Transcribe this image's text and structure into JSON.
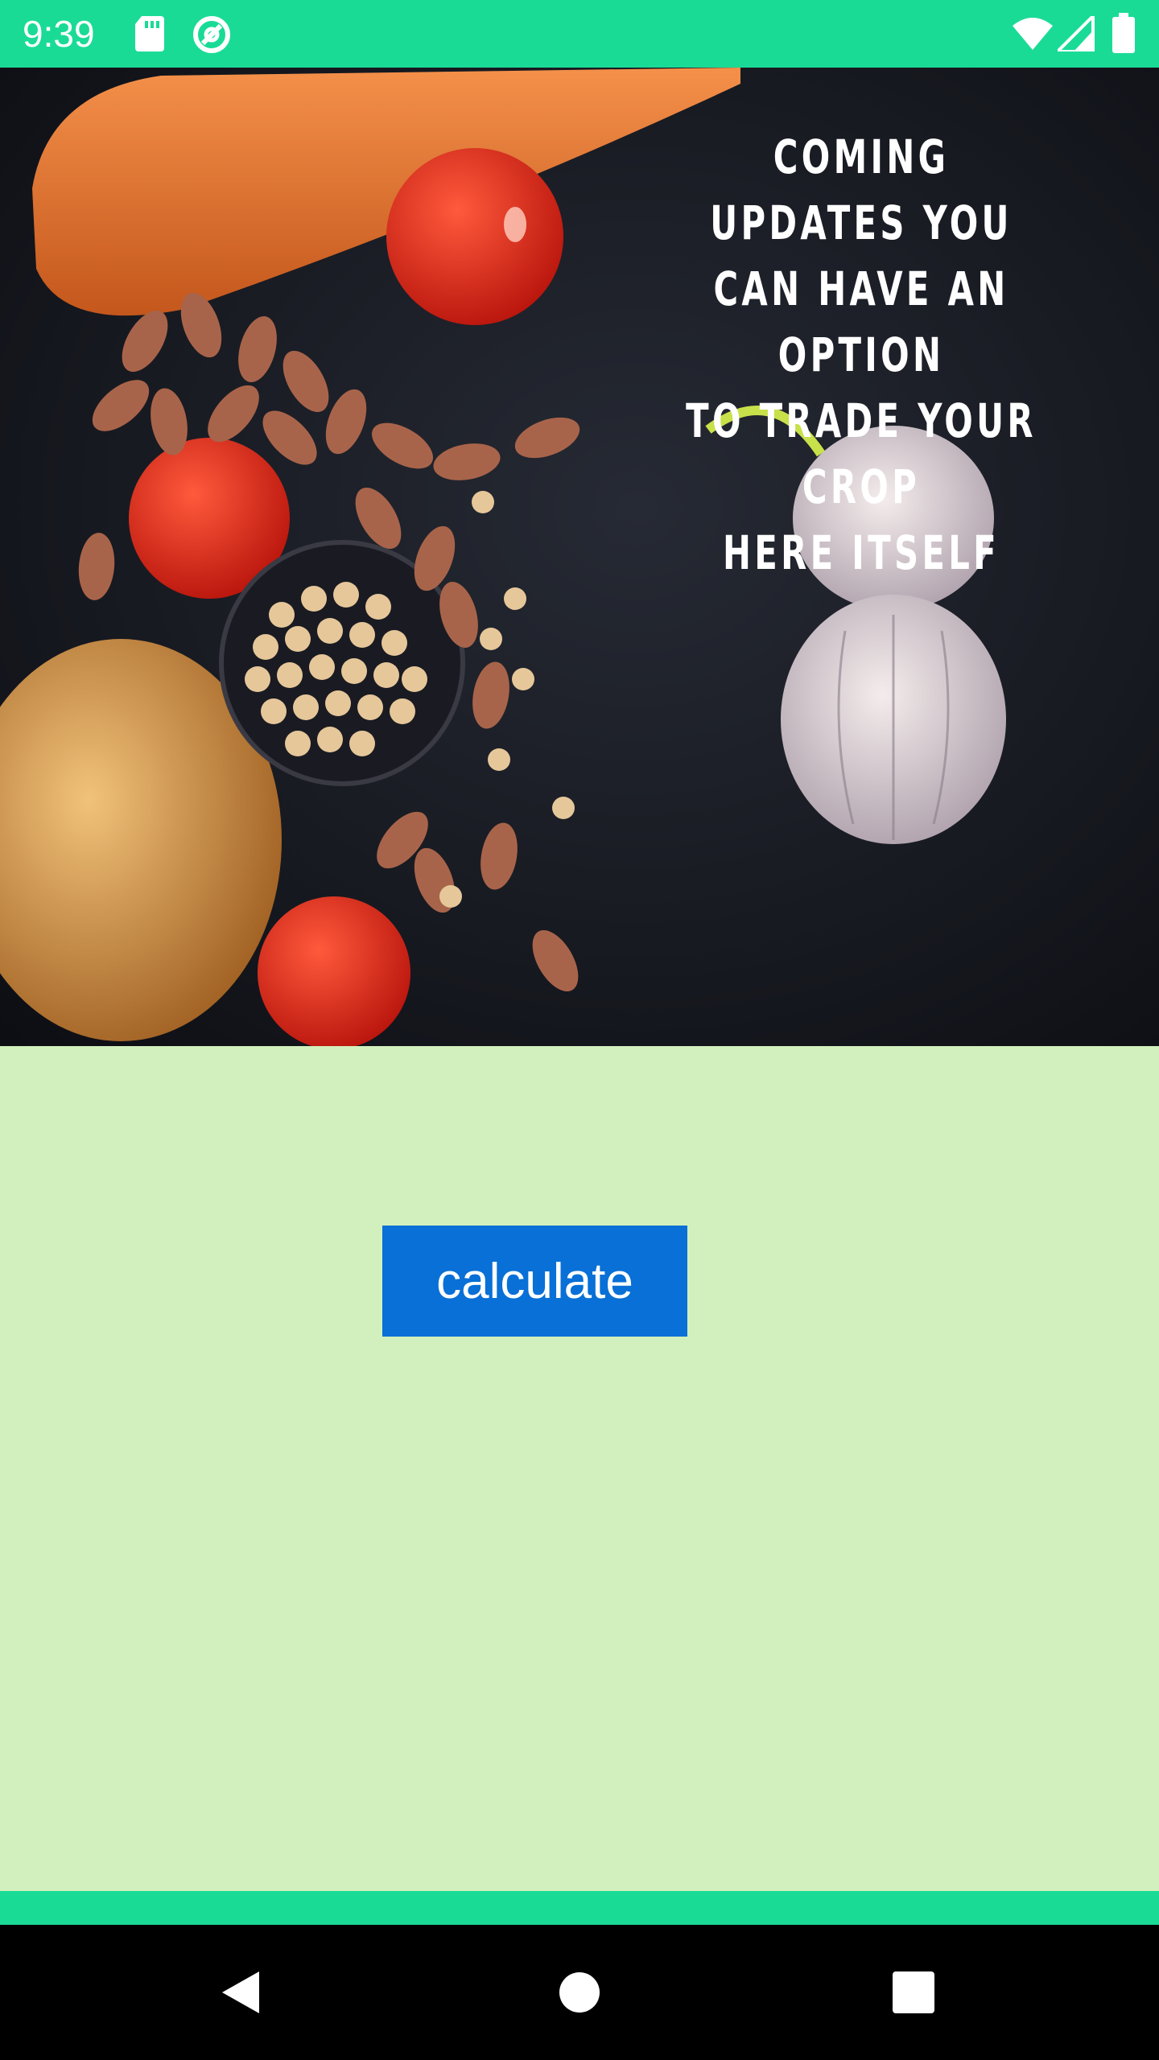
{
  "status_bar": {
    "time": "9:39",
    "icons": [
      "sd-card-icon",
      "sync-icon",
      "wifi-icon",
      "cellular-signal-icon",
      "battery-icon"
    ],
    "color": "#1adb96"
  },
  "hero": {
    "caption": "COMING UPDATES YOU\nCAN HAVE AN OPTION\nTO TRADE YOUR CROP\nHERE ITSELF"
  },
  "main": {
    "calculate_label": "calculate",
    "button_color": "#0870d6",
    "background_color": "#d2f0bd"
  },
  "nav_bar": {
    "icons": [
      "back-icon",
      "home-icon",
      "recents-icon"
    ]
  }
}
